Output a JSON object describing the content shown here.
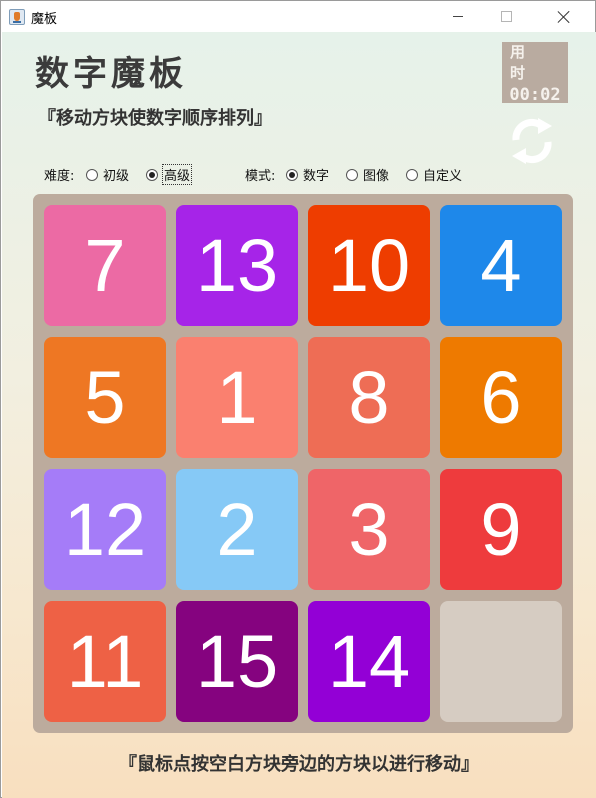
{
  "window": {
    "title": "魔板"
  },
  "header": {
    "title": "数字魔板",
    "subtitle": "『移动方块使数字顺序排列』"
  },
  "timer": {
    "label": "用 时",
    "value": "00:02"
  },
  "options": {
    "difficulty_label": "难度:",
    "difficulty": [
      {
        "label": "初级",
        "checked": false
      },
      {
        "label": "高级",
        "checked": true
      }
    ],
    "mode_label": "模式:",
    "mode": [
      {
        "label": "数字",
        "checked": true
      },
      {
        "label": "图像",
        "checked": false
      },
      {
        "label": "自定义",
        "checked": false
      }
    ]
  },
  "board": {
    "rows": 4,
    "cols": 4,
    "tiles": [
      {
        "value": "7",
        "color": "#ec6aa4"
      },
      {
        "value": "13",
        "color": "#a624e8"
      },
      {
        "value": "10",
        "color": "#ee3d00"
      },
      {
        "value": "4",
        "color": "#1e88ea"
      },
      {
        "value": "5",
        "color": "#ee7723"
      },
      {
        "value": "1",
        "color": "#fa806f"
      },
      {
        "value": "8",
        "color": "#ee6d55"
      },
      {
        "value": "6",
        "color": "#ee7a00"
      },
      {
        "value": "12",
        "color": "#a57cf8"
      },
      {
        "value": "2",
        "color": "#86c9f6"
      },
      {
        "value": "3",
        "color": "#ef6568"
      },
      {
        "value": "9",
        "color": "#ee3b3d"
      },
      {
        "value": "11",
        "color": "#ee6145"
      },
      {
        "value": "15",
        "color": "#85037f"
      },
      {
        "value": "14",
        "color": "#9300d6"
      },
      {
        "value": "",
        "color": "#d6ccc2",
        "blank": true
      }
    ]
  },
  "footer": {
    "hint": "『鼠标点按空白方块旁边的方块以进行移动』"
  },
  "icons": {
    "app": "java-cup-icon",
    "refresh": "refresh-icon"
  }
}
